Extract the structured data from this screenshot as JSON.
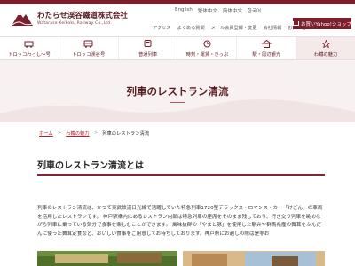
{
  "brand": {
    "name_jp": "わたらせ渓谷鐵道株式会社",
    "name_en": "Watarase Keikoku Railway Co.,Ltd.",
    "primary_color": "#7a1f2b",
    "hero_bg": "#f8f1f1"
  },
  "header": {
    "languages": [
      "English",
      "繁体中文",
      "简体中文",
      "한국어"
    ],
    "utility_links": [
      "アクセス",
      "よくある質問",
      "メール会員登録・変更",
      "会社情報",
      "お問い合わせ"
    ],
    "shop_label": "お買いYahoo!ショップ"
  },
  "nav": {
    "items": [
      {
        "label": "トロッコわっし～号",
        "icon": "trolley-icon"
      },
      {
        "label": "トロッコ渓谷号",
        "icon": "train-icon"
      },
      {
        "label": "普通列車",
        "icon": "local-train-icon"
      },
      {
        "label": "時刻・運賃・きっぷ",
        "icon": "ticket-icon"
      },
      {
        "label": "駅・周辺観光",
        "icon": "station-icon"
      },
      {
        "label": "わ鐵の魅力",
        "icon": "star-icon"
      }
    ],
    "active_index": 5
  },
  "hero": {
    "title": "列車のレストラン清流"
  },
  "breadcrumb": {
    "home": "ホーム",
    "parent": "わ鐵の魅力",
    "separator": ">",
    "current": "列車のレストラン清流"
  },
  "section": {
    "title": "列車のレストラン清流とは",
    "paragraph": "列車のレストラン清流は、かつて東武鉄道日光線で活躍していた特急列車1720型デラックス・ロマンス・カー「けごん」の車両を活用したレストランです。 神戸駅構内にあるレストラン内部は特急列車の座席をそのまま残しており、行き交う列車を眺めながら列車に乗っている気分で食事を楽しむことができます。 風味抜群の「やまと豚」を使用した駅弁や群馬県産の舞茸をふんだんに使った舞茸定食など、おいしい食事をご用意してお待ちしております。神戸駅にお越しの際は是非お"
  }
}
